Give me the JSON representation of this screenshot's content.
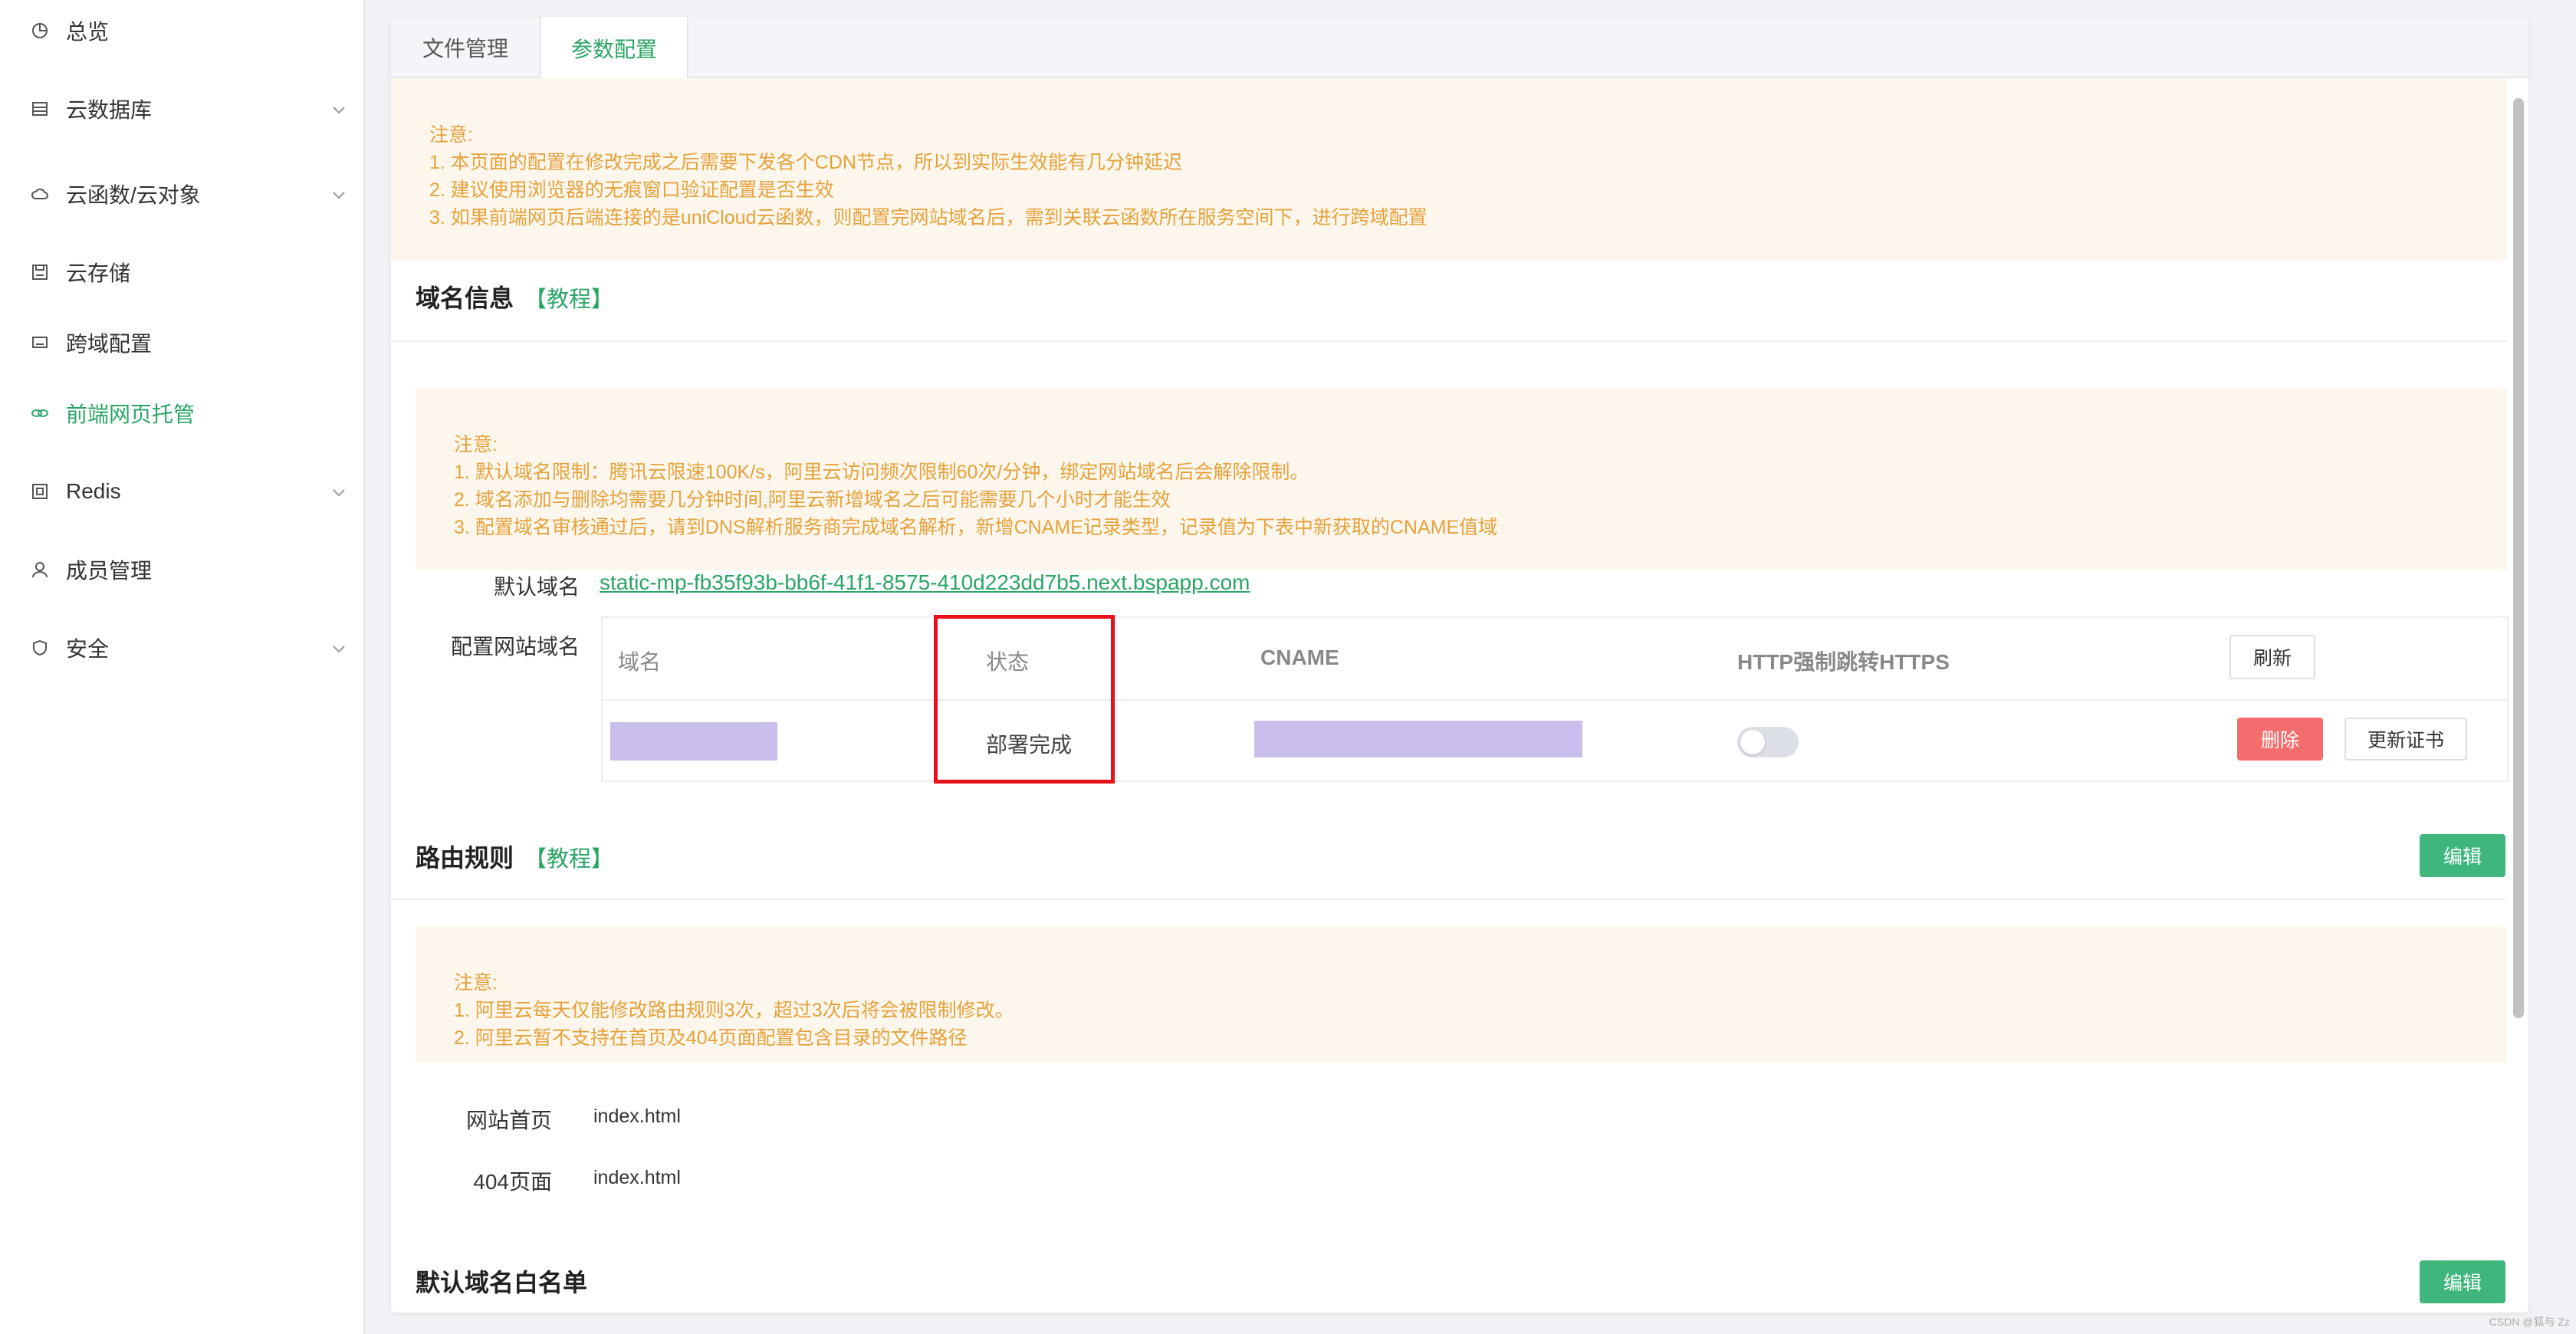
{
  "sidebar": {
    "items": [
      {
        "label": "总览",
        "icon": "pie-chart-icon"
      },
      {
        "label": "云数据库",
        "icon": "database-icon",
        "expandable": true
      },
      {
        "label": "云函数/云对象",
        "icon": "cloud-icon",
        "expandable": true
      },
      {
        "label": "云存储",
        "icon": "save-icon"
      },
      {
        "label": "跨域配置",
        "icon": "monitor-icon"
      },
      {
        "label": "前端网页托管",
        "icon": "link-icon",
        "active": true
      },
      {
        "label": "Redis",
        "icon": "cube-icon",
        "expandable": true
      },
      {
        "label": "成员管理",
        "icon": "user-icon"
      },
      {
        "label": "安全",
        "icon": "shield-icon",
        "expandable": true
      }
    ]
  },
  "tabs": [
    {
      "label": "文件管理"
    },
    {
      "label": "参数配置",
      "active": true
    }
  ],
  "top_notice": {
    "title": "注意:",
    "lines": [
      "1. 本页面的配置在修改完成之后需要下发各个CDN节点，所以到实际生效能有几分钟延迟",
      "2. 建议使用浏览器的无痕窗口验证配置是否生效",
      "3. 如果前端网页后端连接的是uniCloud云函数，则配置完网站域名后，需到关联云函数所在服务空间下，进行跨域配置"
    ]
  },
  "domain_section": {
    "title": "域名信息",
    "tutorial": "【教程】",
    "notice": {
      "title": "注意:",
      "lines": [
        "1. 默认域名限制：腾讯云限速100K/s，阿里云访问频次限制60次/分钟，绑定网站域名后会解除限制。",
        "2. 域名添加与删除均需要几分钟时间,阿里云新增域名之后可能需要几个小时才能生效",
        "3. 配置域名审核通过后，请到DNS解析服务商完成域名解析，新增CNAME记录类型，记录值为下表中新获取的CNAME值域"
      ]
    },
    "default_domain_label": "默认域名",
    "default_domain_value": "static-mp-fb35f93b-bb6f-41f1-8575-410d223dd7b5.next.bspapp.com",
    "site_domain_label": "配置网站域名",
    "table": {
      "headers": {
        "domain": "域名",
        "status": "状态",
        "cname": "CNAME",
        "https": "HTTP强制跳转HTTPS"
      },
      "refresh_label": "刷新",
      "rows": [
        {
          "status": "部署完成",
          "https_enabled": false,
          "delete_label": "删除",
          "renew_label": "更新证书"
        }
      ]
    }
  },
  "route_section": {
    "title": "路由规则",
    "tutorial": "【教程】",
    "edit_label": "编辑",
    "notice": {
      "title": "注意:",
      "lines": [
        "1. 阿里云每天仅能修改路由规则3次，超过3次后将会被限制修改。",
        "2. 阿里云暂不支持在首页及404页面配置包含目录的文件路径"
      ]
    },
    "home_label": "网站首页",
    "home_value": "index.html",
    "notfound_label": "404页面",
    "notfound_value": "index.html"
  },
  "whitelist_section": {
    "title": "默认域名白名单",
    "edit_label": "编辑"
  },
  "watermark": "CSDN @狐与 Zz",
  "colors": {
    "accent": "#2aa565",
    "warning_text": "#e6a23c",
    "warning_bg": "#fdf6ec",
    "danger": "#f56c6c",
    "highlight": "#e8111b"
  }
}
